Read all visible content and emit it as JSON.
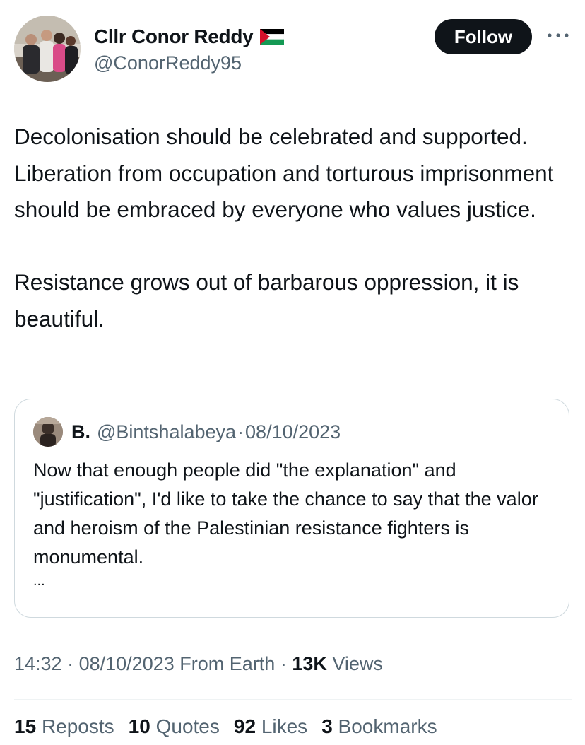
{
  "author": {
    "display_name": "Cllr Conor Reddy",
    "handle": "@ConorReddy95",
    "flag_icon": "palestine-flag-icon"
  },
  "follow_label": "Follow",
  "more_icon": "more-dots-icon",
  "tweet": {
    "paragraph_1": "Decolonisation should be celebrated and supported. Liberation from occupation and torturous imprisonment should be embraced by everyone who values justice.",
    "paragraph_2": "Resistance grows out of barbarous oppression, it is beautiful."
  },
  "quote": {
    "name": "B.",
    "handle": "@Bintshalabeya",
    "separator": "·",
    "date": "08/10/2023",
    "text": "Now that enough people did \"the explanation\" and \"justification\", I'd like to take the chance to say that the valor and heroism of the Palestinian resistance fighters is monumental.",
    "ellipsis": "..."
  },
  "meta": {
    "time": "14:32",
    "separator": "·",
    "date": "08/10/2023",
    "source": "From Earth",
    "views_count": "13K",
    "views_label": "Views"
  },
  "stats": {
    "reposts": {
      "count": "15",
      "label": "Reposts"
    },
    "quotes": {
      "count": "10",
      "label": "Quotes"
    },
    "likes": {
      "count": "92",
      "label": "Likes"
    },
    "bookmarks": {
      "count": "3",
      "label": "Bookmarks"
    }
  },
  "colors": {
    "text_primary": "#0f1419",
    "text_secondary": "#536471",
    "border": "#cfd9de",
    "flag_red": "#d4112a",
    "flag_green": "#149954"
  }
}
